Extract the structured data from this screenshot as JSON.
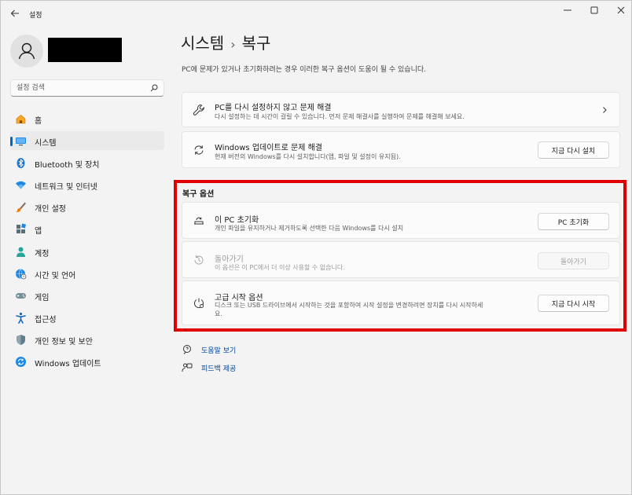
{
  "window": {
    "title": "설정"
  },
  "search": {
    "placeholder": "설정 검색"
  },
  "sidebar": {
    "items": [
      {
        "label": "홈",
        "icon": "home-icon"
      },
      {
        "label": "시스템",
        "icon": "system-monitor-icon",
        "active": true
      },
      {
        "label": "Bluetooth 및 장치",
        "icon": "bluetooth-icon"
      },
      {
        "label": "네트워크 및 인터넷",
        "icon": "wifi-icon"
      },
      {
        "label": "개인 설정",
        "icon": "paintbrush-icon"
      },
      {
        "label": "앱",
        "icon": "apps-icon"
      },
      {
        "label": "계정",
        "icon": "account-icon"
      },
      {
        "label": "시간 및 언어",
        "icon": "globe-clock-icon"
      },
      {
        "label": "게임",
        "icon": "gamepad-icon"
      },
      {
        "label": "접근성",
        "icon": "accessibility-icon"
      },
      {
        "label": "개인 정보 및 보안",
        "icon": "shield-icon"
      },
      {
        "label": "Windows 업데이트",
        "icon": "update-icon"
      }
    ]
  },
  "main": {
    "breadcrumb_parent": "시스템",
    "breadcrumb_separator": "›",
    "breadcrumb_current": "복구",
    "description": "PC에 문제가 있거나 초기화하려는 경우 이러한 복구 옵션이 도움이 될 수 있습니다.",
    "cards": {
      "fix_without_reset": {
        "title": "PC를 다시 설정하지 않고 문제 해결",
        "desc": "다시 설정하는 데 시간이 걸릴 수 있습니다. 먼저 문제 해결사를 실행하여 문제를 해결해 보세요."
      },
      "windows_update_fix": {
        "title": "Windows 업데이트로 문제 해결",
        "desc": "현재 버전의 Windows를 다시 설치합니다(앱, 파일 및 설정이 유지됨).",
        "button": "지금 다시 설치"
      }
    },
    "recovery_options": {
      "section_title": "복구 옵션",
      "reset_pc": {
        "title": "이 PC 초기화",
        "desc": "개인 파일을 유지하거나 제거하도록 선택한 다음 Windows를 다시 설치",
        "button": "PC 초기화"
      },
      "go_back": {
        "title": "돌아가기",
        "desc": "이 옵션은 이 PC에서 더 이상 사용할 수 없습니다.",
        "button": "돌아가기"
      },
      "advanced_startup": {
        "title": "고급 시작 옵션",
        "desc_line1": "디스크 또는 USB 드라이브에서 시작하는 것을 포함하여 시작 설정을 변경하려면 장치를 다시 시작하세",
        "desc_line2": "요.",
        "button": "지금 다시 시작"
      }
    },
    "links": {
      "help": "도움말 보기",
      "feedback": "피드백 제공"
    }
  },
  "colors": {
    "accent": "#0067c0",
    "highlight_box": "#e00000"
  }
}
